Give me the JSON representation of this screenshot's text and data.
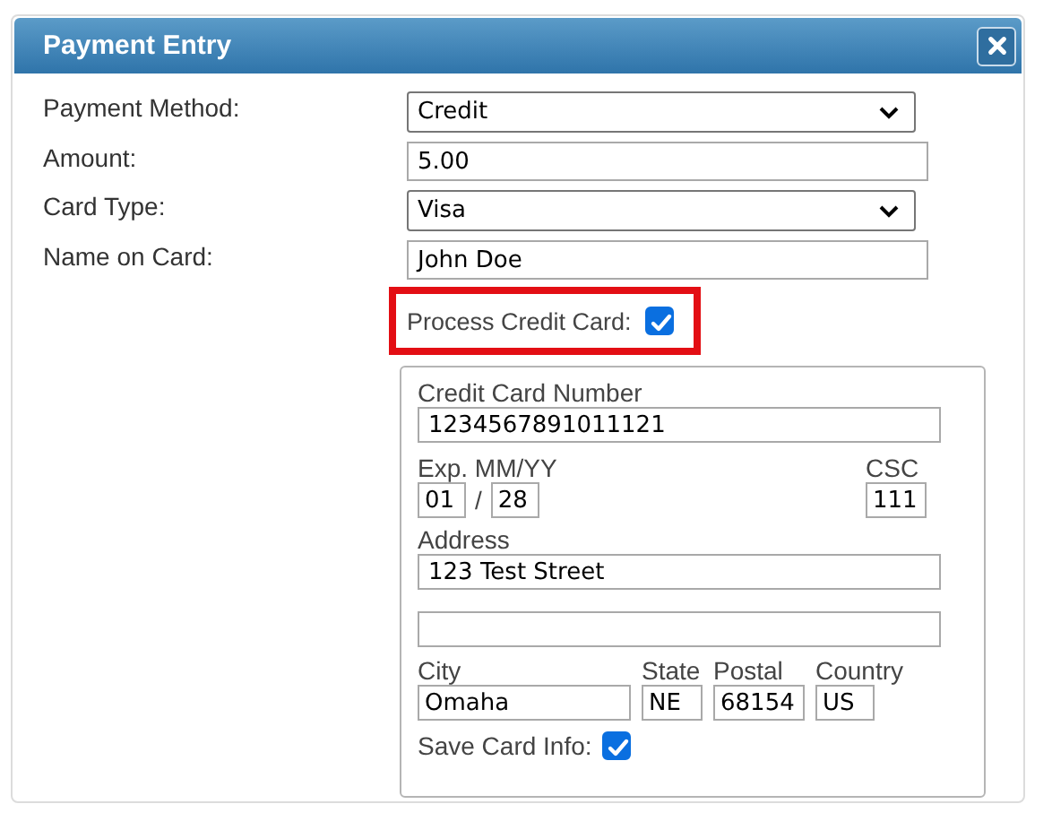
{
  "window": {
    "title": "Payment Entry"
  },
  "fields": [
    {
      "label": "Payment Method:",
      "kind": "select",
      "value": "Credit"
    },
    {
      "label": "Amount:",
      "kind": "text",
      "value": "5.00"
    },
    {
      "label": "Card Type:",
      "kind": "select",
      "value": "Visa"
    },
    {
      "label": "Name on Card:",
      "kind": "text",
      "value": "John Doe"
    }
  ],
  "process_card": {
    "label": "Process Credit Card:",
    "checked": true,
    "highlighted": true
  },
  "card_panel": {
    "number": {
      "label": "Credit Card Number",
      "value": "1234567891011121"
    },
    "expiry": {
      "label": "Exp. MM/YY",
      "month": "01",
      "separator": "/",
      "year": "28"
    },
    "csc": {
      "label": "CSC",
      "value": "111"
    },
    "address": {
      "label": "Address",
      "line1": "123 Test Street"
    },
    "location": [
      {
        "label": "City",
        "value": "Omaha",
        "kind": "city"
      },
      {
        "label": "State",
        "value": "NE",
        "kind": "state"
      },
      {
        "label": "Postal",
        "value": "68154",
        "kind": "postal"
      },
      {
        "label": "Country",
        "value": "US",
        "kind": "country"
      }
    ],
    "save_card": {
      "label": "Save Card Info:",
      "checked": true
    }
  }
}
